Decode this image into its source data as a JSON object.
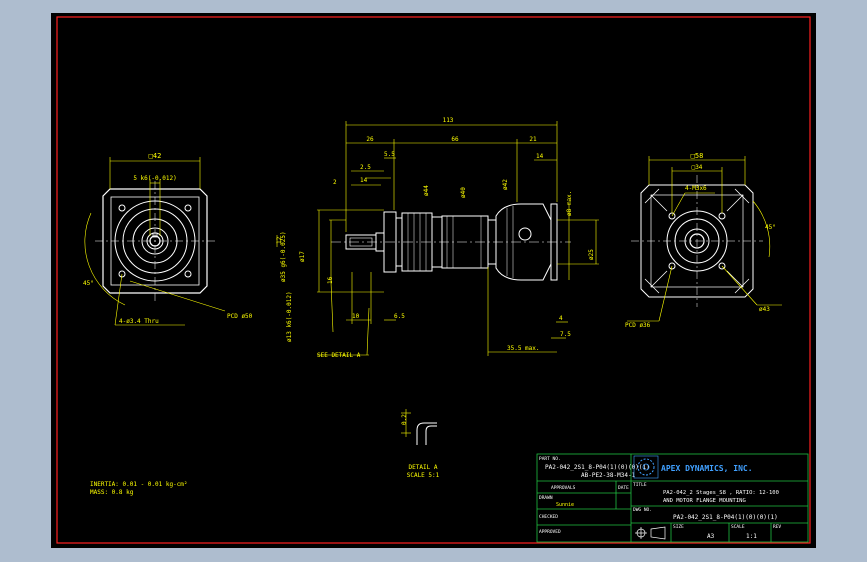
{
  "colors": {
    "background": "#aebdcf",
    "sheet": "#000000",
    "border": "#ff2020",
    "geometry": "#ffffff",
    "dimension": "#ffff00",
    "titleblock": "#20c040",
    "logo": "#40a0ff",
    "hidden": "#2060ff"
  },
  "front_view": {
    "dim_square": "□42",
    "dim_key": "5 k6(-0.012)",
    "dim_12": "12",
    "dim_angle": "45°",
    "dim_pcd": "PCD ø50",
    "note_holes": "4-ø3.4 Thru"
  },
  "side_view": {
    "dim_overall": "113",
    "dim_26": "26",
    "dim_66": "66",
    "dim_21": "21",
    "dim_5_5": "5.5",
    "dim_14": "14",
    "dim_2_5": "2.5",
    "dim_2": "2",
    "dim_14b": "14",
    "dim_d44": "ø44",
    "dim_d40": "ø40",
    "dim_d42": "ø42",
    "dim_d8": "ø8 max.",
    "dim_d25": "ø25",
    "dim_d35": "ø35 g6(-0.025)",
    "dim_d17": "ø17",
    "dim_d13": "ø13 k6(-0.012)",
    "dim_16": "16",
    "dim_10": "10",
    "dim_6_5": "6.5",
    "dim_4": "4",
    "dim_7_5": "7.5",
    "dim_35_5": "35.5 max.",
    "note_detail": "SEE DETAIL A"
  },
  "motor_view": {
    "dim_58": "□58",
    "dim_34": "□34",
    "dim_screws": "4-M3x6",
    "dim_angle": "45°",
    "dim_d43": "ø43",
    "dim_pcd": "PCD ø36"
  },
  "detail": {
    "dim": "0.2",
    "title": "DETAIL A",
    "scale": "SCALE 5:1"
  },
  "notes": {
    "inertia": "INERTIA: 0.01 - 0.01 kg-cm²",
    "mass": "MASS: 0.8 kg"
  },
  "title_block": {
    "part_no_label": "PART NO.",
    "part_no_1": "PA2-042_2S1_8-P04(1)(0)(0)(1)",
    "part_no_2": "AB-PE2-38-M34-1",
    "company": "APEX DYNAMICS, INC.",
    "approvals_label": "APPROVALS",
    "date_label": "DATE",
    "drawn_label": "DRAWN",
    "drawn_by": "Sunnie",
    "checked_label": "CHECKED",
    "approved_label": "APPROVED",
    "title_label": "TITLE",
    "title_1": "PA2-042_2 Stages_S8 , RATIO: 12-100",
    "title_2": "AND MOTOR FLANGE MOUNTING",
    "dwg_no_label": "DWG NO.",
    "dwg_no": "PA2-042_2S1_8-P04(1)(0)(0)(1)",
    "size_label": "SIZE",
    "size": "A3",
    "scale_label": "SCALE",
    "scale": "1:1",
    "rev_label": "REV"
  }
}
